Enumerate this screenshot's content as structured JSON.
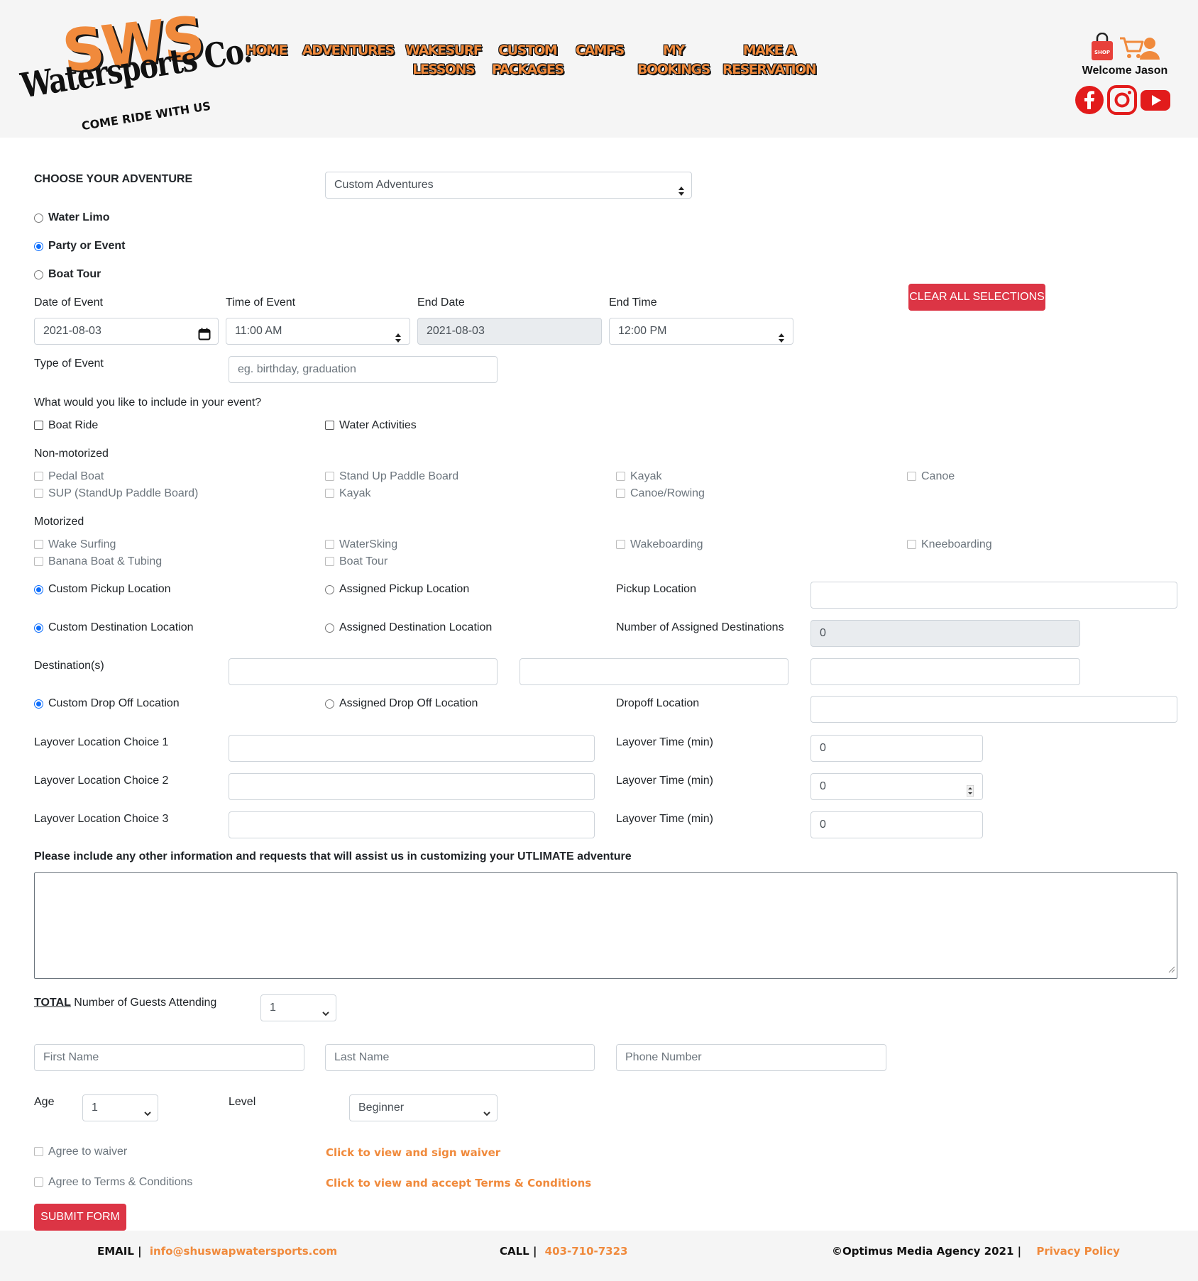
{
  "brand": {
    "logo_main": "SWS",
    "logo_sub": "Watersports Co.",
    "logo_tag": "COME RIDE WITH US"
  },
  "nav": {
    "home": "HOME",
    "adventures": "ADVENTURES",
    "wakesurf_1": "WAKESURF",
    "wakesurf_2": "LESSONS",
    "custom_1": "CUSTOM",
    "custom_2": "PACKAGES",
    "camps": "CAMPS",
    "bookings_1": "MY",
    "bookings_2": "BOOKINGS",
    "reserve_1": "MAKE A",
    "reserve_2": "RESERVATION"
  },
  "user": {
    "welcome": "Welcome Jason",
    "shop_text": "SHOP"
  },
  "form": {
    "choose_label": "CHOOSE YOUR ADVENTURE",
    "adventure_select": "Custom Adventures",
    "adventure_types": [
      "Water Limo",
      "Party or Event",
      "Boat Tour"
    ],
    "selected_type": "Party or Event",
    "clear_button": "CLEAR ALL SELECTIONS",
    "date_of_event_label": "Date of Event",
    "date_of_event": "2021-08-03",
    "time_of_event_label": "Time of Event",
    "time_of_event": "11:00 AM",
    "end_date_label": "End Date",
    "end_date": "2021-08-03",
    "end_time_label": "End Time",
    "end_time": "12:00 PM",
    "type_of_event_label": "Type of Event",
    "type_of_event_placeholder": "eg. birthday, graduation",
    "include_question": "What would you like to include in your event?",
    "boat_ride": "Boat Ride",
    "water_activities": "Water Activities",
    "non_motorized_label": "Non-motorized",
    "non_motorized": [
      "Pedal Boat",
      "Stand Up Paddle Board",
      "Kayak",
      "Canoe",
      "SUP (StandUp Paddle Board)",
      "Kayak",
      "Canoe/Rowing"
    ],
    "motorized_label": "Motorized",
    "motorized": [
      "Wake Surfing",
      "WaterSking",
      "Wakeboarding",
      "Kneeboarding",
      "Banana Boat & Tubing",
      "Boat Tour"
    ],
    "custom_pickup": "Custom Pickup Location",
    "assigned_pickup": "Assigned Pickup Location",
    "pickup_location_label": "Pickup Location",
    "custom_destination": "Custom Destination Location",
    "assigned_destination": "Assigned Destination Location",
    "num_destinations_label": "Number of Assigned Destinations",
    "num_destinations": "0",
    "destinations_label": "Destination(s)",
    "custom_dropoff": "Custom Drop Off Location",
    "assigned_dropoff": "Assigned Drop Off Location",
    "dropoff_location_label": "Dropoff Location",
    "layover_1_label": "Layover Location Choice 1",
    "layover_2_label": "Layover Location Choice 2",
    "layover_3_label": "Layover Location Choice 3",
    "layover_time_label": "Layover Time (min)",
    "layover_time_1": "0",
    "layover_time_2": "0",
    "layover_time_3": "0",
    "other_info_label": "Please include any other information and requests that will assist us in customizing your UTLIMATE adventure",
    "guests_total": "TOTAL",
    "guests_label": " Number of Guests Attending",
    "guests_value": "1",
    "first_name_placeholder": "First Name",
    "last_name_placeholder": "Last Name",
    "phone_placeholder": "Phone Number",
    "age_label": "Age",
    "age_value": "1",
    "level_label": "Level",
    "level_value": "Beginner",
    "agree_waiver": "Agree to waiver",
    "agree_terms": "Agree to Terms & Conditions",
    "waiver_link": "Click to view and sign waiver",
    "terms_link": "Click to view and accept Terms & Conditions",
    "submit": "SUBMIT FORM"
  },
  "footer": {
    "email_label": "EMAIL |",
    "email": "info@shuswapwatersports.com",
    "call_label": "CALL |",
    "phone": "403-710-7323",
    "copyright": "©Optimus Media Agency 2021 |",
    "privacy": "Privacy Policy"
  },
  "colors": {
    "brand_orange": "#f08a3c",
    "accent_red": "#dc3545",
    "radio_blue": "#0d6efd",
    "header_bg": "#f5f5f5"
  }
}
